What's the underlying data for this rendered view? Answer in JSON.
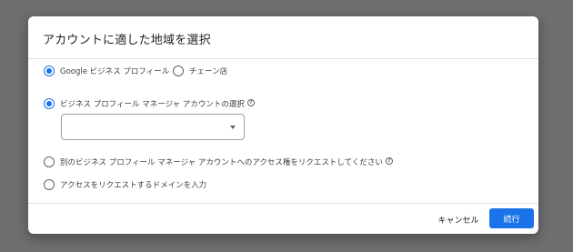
{
  "dialog": {
    "title": "アカウントに適した地域を選択",
    "options_row1": {
      "google_business_profile": "Google ビジネス プロフィール",
      "chain_store": "チェーン店"
    },
    "option_manager_account": "ビジネス プロフィール マネージャ アカウントの選択",
    "manager_account_select_value": "",
    "option_request_access": "別のビジネス プロフィール マネージャ アカウントへのアクセス権をリクエストしてください",
    "option_enter_domain": "アクセスをリクエストするドメインを入力",
    "help_icon_glyph": "?",
    "cancel_label": "キャンセル",
    "continue_label": "続行"
  },
  "icons": {
    "help": "help-circle-icon",
    "dropdown": "dropdown-arrow-icon"
  },
  "colors": {
    "accent": "#1a73e8",
    "overlay": "#6f6f6f"
  }
}
